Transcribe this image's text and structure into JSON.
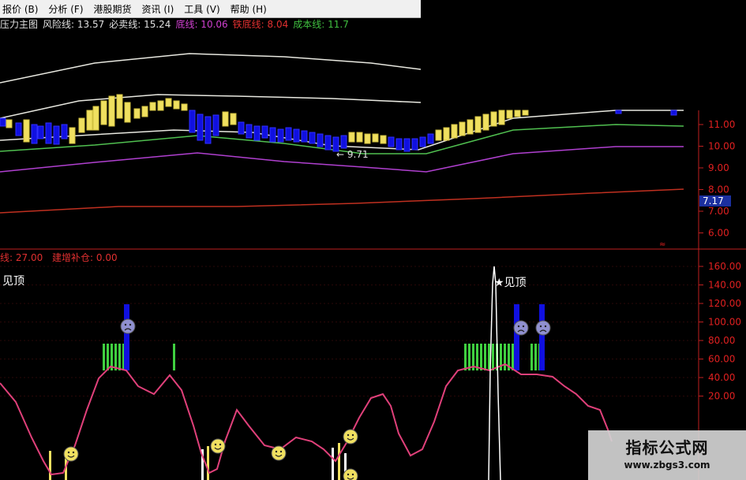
{
  "menu": {
    "items": [
      "报价 (B)",
      "分析 (F)",
      "港股期货",
      "资讯 (I)",
      "工具 (V)",
      "帮助 (H)"
    ]
  },
  "indicators": {
    "main_title": "压力主图",
    "risk_label": "风险线: 13.57",
    "sell_label": "必卖线: 15.24",
    "bottom_label": "底线: 10.06",
    "iron_bottom_label": "铁底线: 8.04",
    "cost_label": "成本线: 11.7"
  },
  "upper_axis": {
    "ticks": [
      "11.00",
      "10.00",
      "9.00",
      "8.00",
      "7.00",
      "6.00"
    ],
    "current_price": "7.17"
  },
  "annotation_low": "← 9.71",
  "lower_indicator": {
    "line_label": "线: 27.00",
    "add_label": "建增补仓: 0.00",
    "top_signal_left": "见顶",
    "top_signal_right": "★见顶"
  },
  "lower_axis": {
    "ticks": [
      "160.00",
      "140.00",
      "120.00",
      "100.00",
      "80.00",
      "60.00",
      "40.00",
      "20.00"
    ]
  },
  "watermark": {
    "title": "指标公式网",
    "url": "www.zbgs3.com"
  },
  "colors": {
    "bull_candle": "#f0e060",
    "bear_candle": "#1010e0",
    "oscillator": "#e0407a",
    "top_bar": "#40d040",
    "axis": "#e02020",
    "white_band": "#e8e8e0",
    "green_band": "#50c050",
    "purple_band": "#b040d0",
    "red_band": "#c03020"
  }
}
